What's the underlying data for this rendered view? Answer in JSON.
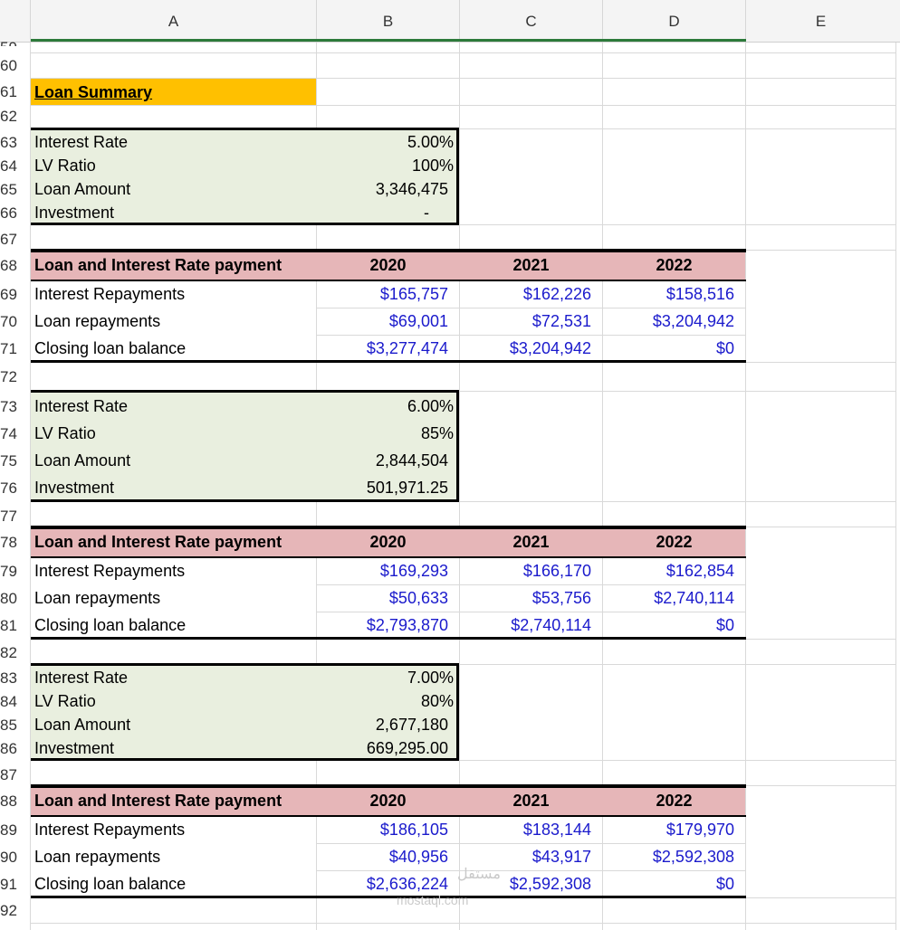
{
  "columns": [
    "A",
    "B",
    "C",
    "D",
    "E"
  ],
  "partial_row_top": "59",
  "rows": [
    "60",
    "61",
    "62",
    "63",
    "64",
    "65",
    "66",
    "67",
    "68",
    "69",
    "70",
    "71",
    "72",
    "73",
    "74",
    "75",
    "76",
    "77",
    "78",
    "79",
    "80",
    "81",
    "82",
    "83",
    "84",
    "85",
    "86",
    "87",
    "88",
    "89",
    "90",
    "91",
    "92"
  ],
  "title": "Loan Summary",
  "block1": {
    "params": [
      {
        "label": "Interest Rate",
        "value": "5.00%"
      },
      {
        "label": "LV Ratio",
        "value": "100%"
      },
      {
        "label": "Loan Amount",
        "value": "3,346,475"
      },
      {
        "label": "Investment",
        "value": "-"
      }
    ],
    "header": {
      "label": "Loan and Interest Rate payment",
      "years": [
        "2020",
        "2021",
        "2022"
      ]
    },
    "rows": [
      {
        "label": "Interest Repayments",
        "values": [
          "$165,757",
          "$162,226",
          "$158,516"
        ]
      },
      {
        "label": "Loan repayments",
        "values": [
          "$69,001",
          "$72,531",
          "$3,204,942"
        ]
      },
      {
        "label": "Closing loan balance",
        "values": [
          "$3,277,474",
          "$3,204,942",
          "$0"
        ]
      }
    ]
  },
  "block2": {
    "params": [
      {
        "label": "Interest Rate",
        "value": "6.00%"
      },
      {
        "label": "LV Ratio",
        "value": "85%"
      },
      {
        "label": "Loan Amount",
        "value": "2,844,504"
      },
      {
        "label": "Investment",
        "value": "501,971.25"
      }
    ],
    "header": {
      "label": "Loan and Interest Rate payment",
      "years": [
        "2020",
        "2021",
        "2022"
      ]
    },
    "rows": [
      {
        "label": "Interest Repayments",
        "values": [
          "$169,293",
          "$166,170",
          "$162,854"
        ]
      },
      {
        "label": "Loan repayments",
        "values": [
          "$50,633",
          "$53,756",
          "$2,740,114"
        ]
      },
      {
        "label": "Closing loan balance",
        "values": [
          "$2,793,870",
          "$2,740,114",
          "$0"
        ]
      }
    ]
  },
  "block3": {
    "params": [
      {
        "label": "Interest Rate",
        "value": "7.00%"
      },
      {
        "label": "LV Ratio",
        "value": "80%"
      },
      {
        "label": "Loan Amount",
        "value": "2,677,180"
      },
      {
        "label": "Investment",
        "value": "669,295.00"
      }
    ],
    "header": {
      "label": "Loan and Interest Rate payment",
      "years": [
        "2020",
        "2021",
        "2022"
      ]
    },
    "rows": [
      {
        "label": "Interest Repayments",
        "values": [
          "$186,105",
          "$183,144",
          "$179,970"
        ]
      },
      {
        "label": "Loan repayments",
        "values": [
          "$40,956",
          "$43,917",
          "$2,592,308"
        ]
      },
      {
        "label": "Closing loan balance",
        "values": [
          "$2,636,224",
          "$2,592,308",
          "$0"
        ]
      }
    ]
  },
  "watermark": {
    "arabic": "مستقل",
    "latin": "mostaql.com"
  },
  "colors": {
    "header_green": "#2c7a3a",
    "param_fill": "#e9efdf",
    "table_header_fill": "#e6b6b8",
    "title_fill": "#ffc000",
    "value_blue": "#1a1acc"
  }
}
